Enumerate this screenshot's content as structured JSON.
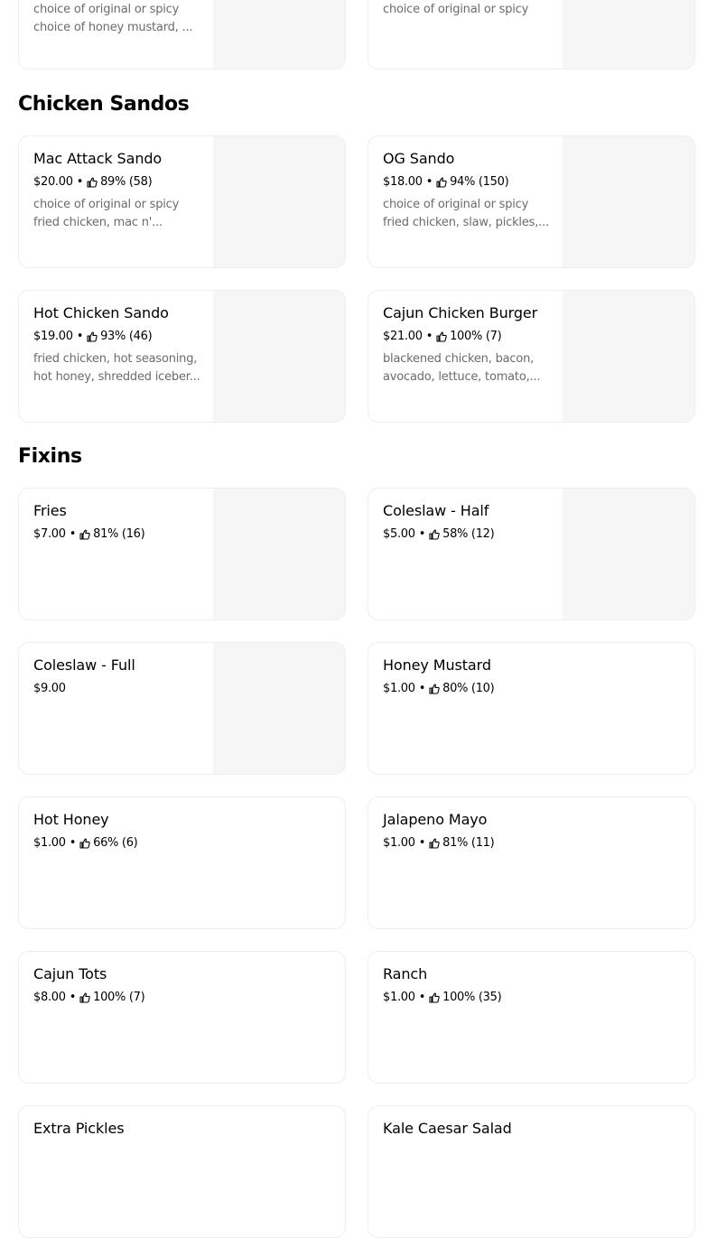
{
  "top_items": [
    {
      "desc": "choice of original or spicy choice of honey mustard, ..."
    },
    {
      "desc": "choice of original or spicy"
    }
  ],
  "sections": [
    {
      "title": "Chicken Sandos",
      "items": [
        {
          "name": "Mac Attack Sando",
          "price": "$20.00",
          "rating": "89% (58)",
          "desc": "choice of original or spicy fried chicken, mac n'..."
        },
        {
          "name": "OG Sando",
          "price": "$18.00",
          "rating": "94% (150)",
          "desc": "choice of original or spicy fried chicken, slaw, pickles,..."
        },
        {
          "name": "Hot Chicken Sando",
          "price": "$19.00",
          "rating": "93% (46)",
          "desc": "fried chicken, hot seasoning, hot honey, shredded iceber..."
        },
        {
          "name": "Cajun Chicken Burger",
          "price": "$21.00",
          "rating": "100% (7)",
          "desc": "blackened chicken, bacon, avocado, lettuce, tomato,..."
        }
      ]
    },
    {
      "title": "Fixins",
      "items": [
        {
          "name": "Fries",
          "price": "$7.00",
          "rating": "81% (16)"
        },
        {
          "name": "Coleslaw - Half",
          "price": "$5.00",
          "rating": "58% (12)"
        },
        {
          "name": "Coleslaw - Full",
          "price": "$9.00"
        },
        {
          "name": "Honey Mustard",
          "price": "$1.00",
          "rating": "80% (10)"
        },
        {
          "name": "Hot Honey",
          "price": "$1.00",
          "rating": "66% (6)"
        },
        {
          "name": "Jalapeno Mayo",
          "price": "$1.00",
          "rating": "81% (11)"
        },
        {
          "name": "Cajun Tots",
          "price": "$8.00",
          "rating": "100% (7)"
        },
        {
          "name": "Ranch",
          "price": "$1.00",
          "rating": "100% (35)"
        },
        {
          "name": "Extra Pickles"
        },
        {
          "name": "Kale Caesar Salad"
        }
      ]
    }
  ],
  "separator": "•",
  "icons": {
    "rating": "thumbs-up-icon"
  }
}
